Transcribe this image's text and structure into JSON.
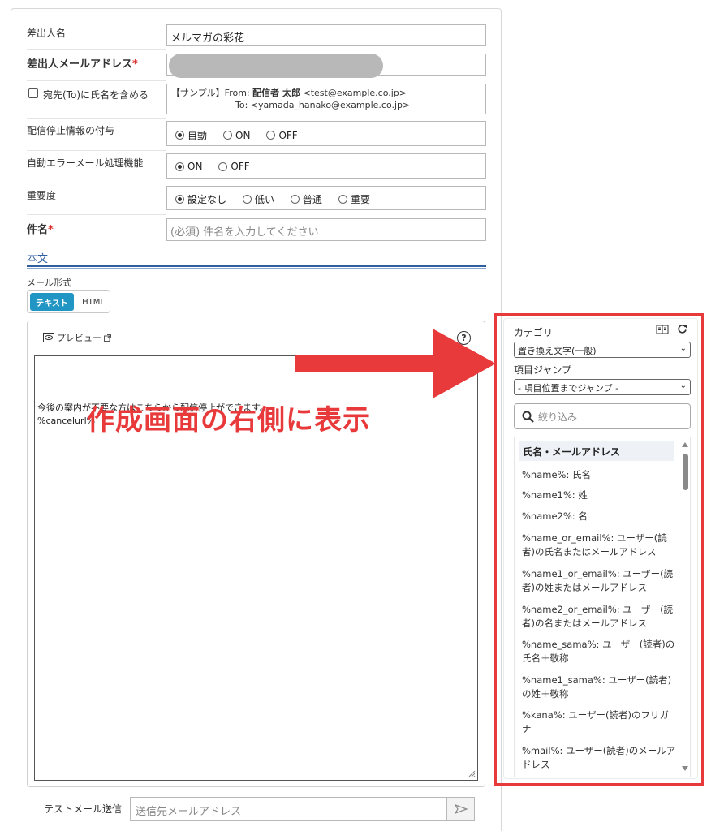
{
  "form": {
    "sender_name_label": "差出人名",
    "sender_name_value": "メルマガの彩花",
    "sender_email_label": "差出人メールアドレス",
    "required_mark": "*",
    "include_name_label": "宛先(To)に氏名を含める",
    "sample_line1_prefix": "【サンプル】From: ",
    "sample_line1_name": "配信者 太郎",
    "sample_line1_addr": " <test@example.co.jp>",
    "sample_line2": "To: <yamada_hanako@example.co.jp>",
    "unsub_label": "配信停止情報の付与",
    "unsub_options": [
      "自動",
      "ON",
      "OFF"
    ],
    "error_label": "自動エラーメール処理機能",
    "error_options": [
      "ON",
      "OFF"
    ],
    "priority_label": "重要度",
    "priority_options": [
      "設定なし",
      "低い",
      "普通",
      "重要"
    ],
    "subject_label": "件名",
    "subject_placeholder": "(必須) 件名を入力してください"
  },
  "body_section": {
    "title": "本文",
    "format_label": "メール形式",
    "format_text": "テキスト",
    "format_html": "HTML",
    "preview_label": "プレビュー",
    "help_glyph": "?",
    "body_line1": "今後の案内が不要な方はこちらから配信停止ができます。",
    "body_line2": "%cancelurl%"
  },
  "test_send": {
    "label": "テストメール送信",
    "placeholder": "送信先メールアドレス"
  },
  "annotation": {
    "text": "作成画面の右側に表示",
    "color": "#e8393b"
  },
  "sidebar": {
    "category_label": "カテゴリ",
    "category_value": "置き換え文字(一般)",
    "jump_label": "項目ジャンプ",
    "jump_value": "- 項目位置までジャンプ -",
    "filter_placeholder": "絞り込み",
    "group_header": "氏名・メールアドレス",
    "variables": [
      "%name%: 氏名",
      "%name1%: 姓",
      "%name2%: 名",
      "%name_or_email%: ユーザー(読者)の氏名またはメールアドレス",
      "%name1_or_email%: ユーザー(読者)の姓またはメールアドレス",
      "%name2_or_email%: ユーザー(読者)の名またはメールアドレス",
      "%name_sama%: ユーザー(読者)の氏名＋敬称",
      "%name1_sama%: ユーザー(読者)の姓＋敬称",
      "%kana%: ユーザー(読者)のフリガナ",
      "%mail%: ユーザー(読者)のメールアドレス"
    ]
  },
  "colors": {
    "accent": "#2196c4",
    "section": "#2f5fa0",
    "highlight": "#e8393b"
  }
}
